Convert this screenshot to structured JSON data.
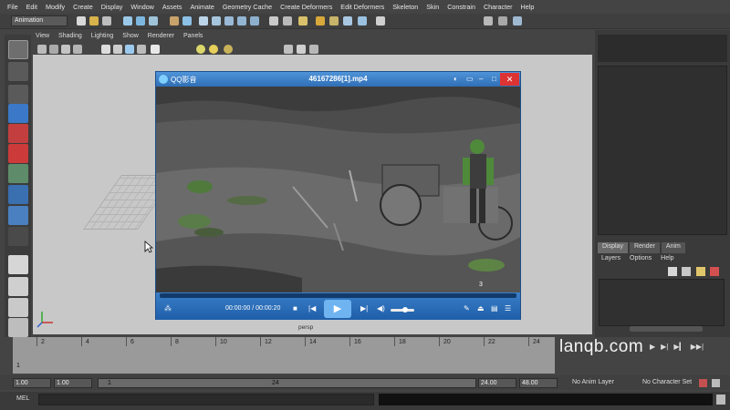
{
  "menubar": [
    "File",
    "Edit",
    "Modify",
    "Create",
    "Display",
    "Window",
    "Assets",
    "Animate",
    "Geometry Cache",
    "Create Deformers",
    "Edit Deformers",
    "Skeleton",
    "Skin",
    "Constrain",
    "Character",
    "Help"
  ],
  "mode": "Animation",
  "panel_menu": [
    "View",
    "Shading",
    "Lighting",
    "Show",
    "Renderer",
    "Panels"
  ],
  "viewport_camera": "persp",
  "layer_tabs": [
    "Display",
    "Render",
    "Anim"
  ],
  "layer_menu": [
    "Layers",
    "Options",
    "Help"
  ],
  "timeline": {
    "ticks": [
      "2",
      "4",
      "6",
      "8",
      "10",
      "12",
      "14",
      "16",
      "18",
      "20",
      "22",
      "24"
    ],
    "start_frame": "1"
  },
  "range": {
    "start": "1.00",
    "start2": "1.00",
    "slider_start": "1",
    "slider_end": "24",
    "end": "24.00",
    "end2": "48.00",
    "anim_layer": "No Anim Layer",
    "char_set": "No Character Set"
  },
  "command_line": {
    "label": "MEL"
  },
  "watermark": "lanqb.com",
  "player": {
    "app_name": "QQ影音",
    "file_name": "46167286[1].mp4",
    "time": "00:00:00 / 00:00:20",
    "subtitle_mark": "3",
    "volume_level": 0.65
  },
  "colors": {
    "player_blue": "#2d6fb8",
    "close_red": "#d33333",
    "viewport_gray": "#c8c8c8"
  }
}
